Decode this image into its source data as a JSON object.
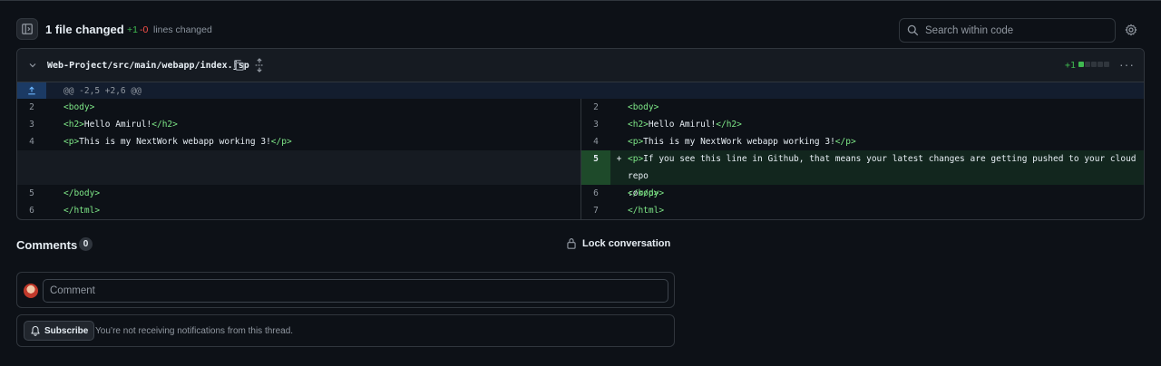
{
  "toolbar": {
    "files_changed": "1 file changed",
    "additions": "+1",
    "deletions": "-0",
    "lines_changed_label": "lines changed",
    "search_placeholder": "Search within code"
  },
  "file": {
    "path": "Web-Project/src/main/webapp/index.jsp",
    "stat_additions": "+1",
    "stat_blocks": [
      "added",
      "neutral",
      "neutral",
      "neutral",
      "neutral"
    ],
    "hunk_header": "@@ -2,5 +2,6 @@"
  },
  "diff": {
    "left": [
      {
        "num": "2",
        "code": "<body>"
      },
      {
        "num": "3",
        "code": "<h2>Hello Amirul!</h2>"
      },
      {
        "num": "4",
        "code": "<p>This is my NextWork webapp working 3!</p>"
      },
      {
        "num": "",
        "code": ""
      },
      {
        "num": "5",
        "code": "</body>"
      },
      {
        "num": "6",
        "code": "</html>"
      }
    ],
    "right": [
      {
        "num": "2",
        "code": "<body>"
      },
      {
        "num": "3",
        "code": "<h2>Hello Amirul!</h2>"
      },
      {
        "num": "4",
        "code": "<p>This is my NextWork webapp working 3!</p>"
      },
      {
        "num": "5",
        "marker": "+",
        "code": "<p>If you see this line in Github, that means your latest changes are getting pushed to your cloud repo\n:o</p>"
      },
      {
        "num": "6",
        "code": "</body>"
      },
      {
        "num": "7",
        "code": "</html>"
      }
    ]
  },
  "comments": {
    "title": "Comments",
    "count": "0",
    "lock_label": "Lock conversation",
    "input_placeholder": "Comment",
    "subscribe_label": "Subscribe",
    "notification_text": "You’re not receiving notifications from this thread."
  },
  "colors": {
    "background": "#0d1117",
    "addition": "#3fb950",
    "deletion": "#f85149",
    "tag": "#7ee787",
    "added_row": "#12261e"
  }
}
